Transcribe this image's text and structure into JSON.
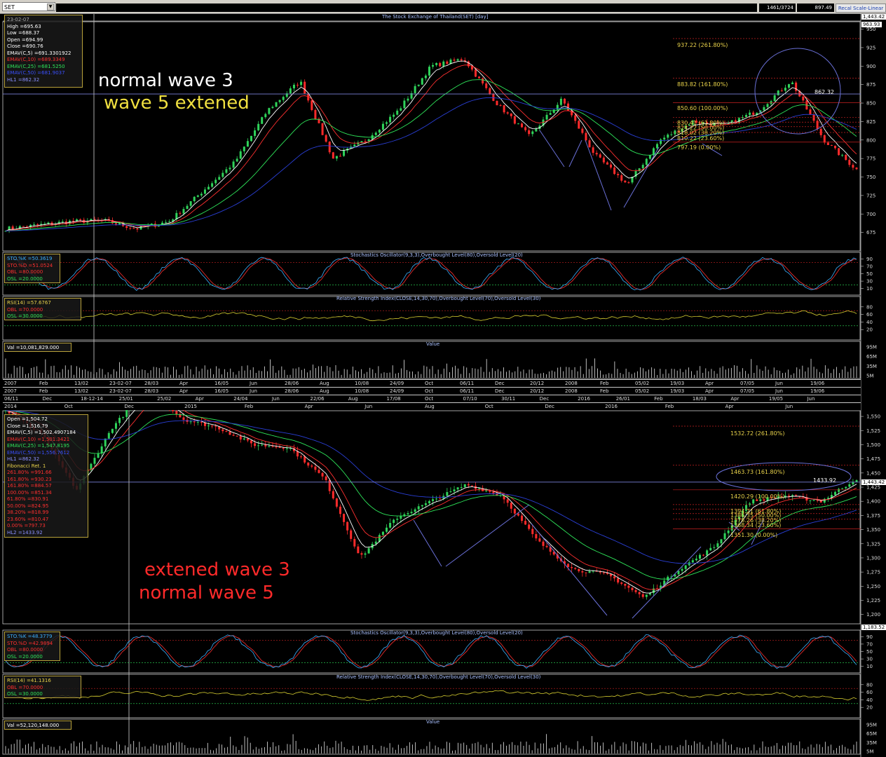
{
  "toolbar": {
    "symbol": "SET",
    "position": "1461/3724",
    "last_value": "897.49",
    "recalc_label": "Recal Scale-Linear"
  },
  "colors": {
    "up_candle": "#2fd35a",
    "down_candle": "#ff2b2b",
    "ema5": "#ffffff",
    "ema10": "#ff3030",
    "ema25": "#2ee65a",
    "ema50": "#2a3fd6",
    "hline": "#7a80d8",
    "stoch_k": "#3ab0ff",
    "stoch_d": "#ff3030",
    "rsi": "#d8d030",
    "volume": "#e8e8e8",
    "box_border": "#b8a23a"
  },
  "top": {
    "title": "The Stock Exchange of Thailand(SET) [day]",
    "annotation_white": "normal wave 3",
    "annotation_yellow": "wave 5 extened",
    "info": {
      "date": "23-02-07",
      "high": "High  =695.63",
      "low": "Low  =688.37",
      "open": "Open  =694.99",
      "close": "Close  =690.76",
      "ema5": "EMAV(C,5)  =691.3301922",
      "ema10": "EMAV(C,10)  =689.3349",
      "ema25": "EMAV(C,25)  =681.5250",
      "ema50": "EMAV(C,50)  =681.9037",
      "hl": "HL1 =862.32"
    },
    "right_labels": {
      "top": "1,443.42",
      "second": "963.93"
    },
    "fib_labels": [
      "937.22 (261.80%)",
      "883.82 (161.80%)",
      "850.60 (100.00%)",
      "830.41 (61.80%)",
      "824.22 (50.00%)",
      "818.02 (38.20%)",
      "810.22 (23.60%)",
      "797.19 (0.00%)"
    ],
    "hl_label": "862.32",
    "stoch": {
      "title": "Stochastics Oscillator(9,3,3),Overbought Level(80),Oversold Level(20)",
      "k": "STO.%K  =50.3619",
      "d": "STO.%D  =51.0524",
      "ob": "OBL  =80.0000",
      "os": "OSL  =20.0000"
    },
    "rsi": {
      "title": "Relative Strength Index(CLOSE,14,30,70),Overbought Level(70),Oversold Level(30)",
      "value": "RSI(14)  =57.6767",
      "ob": "OBL  =70.0000",
      "os": "OSL  =30.0000"
    },
    "volume": {
      "title": "Value",
      "value": "Val  =10,081,829.000"
    },
    "dates_row1": [
      "2007",
      "Feb",
      "13/02",
      "23-02-07",
      "28/03",
      "Apr",
      "16/05",
      "Jun",
      "28/06",
      "Aug",
      "10/08",
      "24/09",
      "Oct",
      "06/11",
      "Dec",
      "20/12",
      "2008",
      "Feb",
      "05/02",
      "19/03",
      "Apr",
      "07/05",
      "Jun",
      "19/06"
    ],
    "dates_row2": [
      "06/11",
      "Dec",
      "18-12-14",
      "25/01",
      "25/02",
      "Apr",
      "24/04",
      "Jun",
      "22/06",
      "Aug",
      "17/08",
      "Oct",
      "07/10",
      "30/11",
      "Dec",
      "2016",
      "26/01",
      "Feb",
      "18/03",
      "Apr",
      "19/05",
      "Jun"
    ]
  },
  "bottom": {
    "annotation_1": "extened wave 3",
    "annotation_2": "normal wave 5",
    "info": {
      "open": "Open  =1,504.72",
      "close": "Close  =1,516.79",
      "ema5": "EMAV(C,5)  =1,502.4907184",
      "ema10": "EMAV(C,10)  =1,501.3421",
      "ema25": "EMAV(C,25)  =1,547.8195",
      "ema50": "EMAV(C,50)  =1,556.7612",
      "hl1": "HL1 =862.32",
      "fib_title": "Fibonacci Ret. 1",
      "fib_rows": [
        "261.80% =991.66",
        "161.80% =930.23",
        "161.80% =884.57",
        "100.00% =851.34",
        "61.80% =830.91",
        "50.00% =824.95",
        "38.20% =818.99",
        "23.60% =810.47",
        "0.00% =797.73"
      ],
      "hl2": "HL2 =1433.92"
    },
    "fib_labels": [
      "1532.72 (261.80%)",
      "1463.73 (161.80%)",
      "1420.29 (100.00%)",
      "1394.21 (61.80%)",
      "1386.35 (50.00%)",
      "1378.26 (38.20%)",
      "1368.34 (23.60%)",
      "1351.30 (0.00%)"
    ],
    "hl_label": "1433.92",
    "right_labels": {
      "hl": "1,443.42",
      "bottom": "1,183.52"
    },
    "stoch": {
      "title": "Stochastics Oscillator(9,3,3),Overbought Level(80),Oversold Level(20)",
      "k": "STO.%K  =48.3779",
      "d": "STO.%D  =42.9894",
      "ob": "OBL  =80.0000",
      "os": "OSL  =20.0000"
    },
    "rsi": {
      "title": "Relative Strength Index(CLOSE,14,30,70),Overbought Level(70),Oversold Level(30)",
      "value": "RSI(14)  =41.1316",
      "ob": "OBL  =70.0000",
      "os": "OSL  =30.0000"
    },
    "volume": {
      "title": "Value",
      "value": "Val  =52,120,148.000"
    },
    "dates_row": [
      "2014",
      "Oct",
      "Dec",
      "2015",
      "Feb",
      "Apr",
      "Jun",
      "Aug",
      "Oct",
      "Dec",
      "2016",
      "Feb",
      "Apr",
      "Jun"
    ]
  },
  "chart_data": [
    {
      "type": "candlestick",
      "title": "The Stock Exchange of Thailand(SET) [day]",
      "ylim": [
        650,
        960
      ],
      "y_ticks": [
        675,
        700,
        725,
        750,
        775,
        800,
        825,
        850,
        875,
        900,
        925,
        950
      ],
      "x_range": [
        "Jan 2007",
        "Jun 2008"
      ],
      "close_path": [
        {
          "x": "Jan 2007",
          "y": 680
        },
        {
          "x": "Feb 2007",
          "y": 685
        },
        {
          "x": "13/02",
          "y": 690
        },
        {
          "x": "23-02-07",
          "y": 691
        },
        {
          "x": "28/03",
          "y": 680
        },
        {
          "x": "Apr 2007",
          "y": 690
        },
        {
          "x": "16/05",
          "y": 730
        },
        {
          "x": "Jun 2007",
          "y": 770
        },
        {
          "x": "28/06",
          "y": 840
        },
        {
          "x": "Jul 2007",
          "y": 880
        },
        {
          "x": "Aug 2007",
          "y": 775
        },
        {
          "x": "10/08",
          "y": 800
        },
        {
          "x": "24/09",
          "y": 840
        },
        {
          "x": "Oct 2007",
          "y": 900
        },
        {
          "x": "Oct 2007 high",
          "y": 910
        },
        {
          "x": "06/11",
          "y": 850
        },
        {
          "x": "Dec 2007",
          "y": 805
        },
        {
          "x": "20/12",
          "y": 855
        },
        {
          "x": "2008",
          "y": 780
        },
        {
          "x": "Jan 2008 low",
          "y": 740
        },
        {
          "x": "Feb 2008",
          "y": 800
        },
        {
          "x": "05/02",
          "y": 825
        },
        {
          "x": "19/03",
          "y": 820
        },
        {
          "x": "Apr 2008",
          "y": 840
        },
        {
          "x": "07/05",
          "y": 880
        },
        {
          "x": "Jun 2008",
          "y": 800
        },
        {
          "x": "19/06",
          "y": 760
        }
      ],
      "hline": 862.32,
      "fibonacci": [
        {
          "level": "261.80%",
          "value": 937.22
        },
        {
          "level": "161.80%",
          "value": 883.82
        },
        {
          "level": "100.00%",
          "value": 850.6
        },
        {
          "level": "61.80%",
          "value": 830.41
        },
        {
          "level": "50.00%",
          "value": 824.22
        },
        {
          "level": "38.20%",
          "value": 818.02
        },
        {
          "level": "23.60%",
          "value": 810.22
        },
        {
          "level": "0.00%",
          "value": 797.19
        }
      ]
    },
    {
      "type": "candlestick",
      "ylim": [
        1183.52,
        1560
      ],
      "y_ticks": [
        1200,
        1225,
        1250,
        1275,
        1300,
        1325,
        1350,
        1375,
        1400,
        1425,
        1450,
        1475,
        1500,
        1525,
        1550
      ],
      "x_range": [
        "Nov 2014",
        "Jun 2016"
      ],
      "close_path": [
        {
          "x": "06/11",
          "y": 1560
        },
        {
          "x": "Dec 2014",
          "y": 1520
        },
        {
          "x": "18-12-14",
          "y": 1420
        },
        {
          "x": "25/01",
          "y": 1530
        },
        {
          "x": "25/02",
          "y": 1600
        },
        {
          "x": "Apr 2015",
          "y": 1545
        },
        {
          "x": "24/04",
          "y": 1530
        },
        {
          "x": "Jun 2015",
          "y": 1500
        },
        {
          "x": "22/06",
          "y": 1495
        },
        {
          "x": "Jul 2015",
          "y": 1440
        },
        {
          "x": "Aug 2015",
          "y": 1300
        },
        {
          "x": "17/08",
          "y": 1370
        },
        {
          "x": "Sep 2015",
          "y": 1400
        },
        {
          "x": "07/10",
          "y": 1430
        },
        {
          "x": "Oct 2015",
          "y": 1410
        },
        {
          "x": "Nov 2015",
          "y": 1330
        },
        {
          "x": "30/11",
          "y": 1280
        },
        {
          "x": "Dec 2015",
          "y": 1270
        },
        {
          "x": "2016",
          "y": 1230
        },
        {
          "x": "26/01",
          "y": 1280
        },
        {
          "x": "Feb 2016",
          "y": 1320
        },
        {
          "x": "18/03",
          "y": 1400
        },
        {
          "x": "Apr 2016",
          "y": 1410
        },
        {
          "x": "19/05",
          "y": 1400
        },
        {
          "x": "Jun 2016",
          "y": 1440
        }
      ],
      "hline": 1433.92,
      "fibonacci": [
        {
          "level": "261.80%",
          "value": 1532.72
        },
        {
          "level": "161.80%",
          "value": 1463.73
        },
        {
          "level": "100.00%",
          "value": 1420.29
        },
        {
          "level": "61.80%",
          "value": 1394.21
        },
        {
          "level": "50.00%",
          "value": 1386.35
        },
        {
          "level": "38.20%",
          "value": 1378.26
        },
        {
          "level": "23.60%",
          "value": 1368.34
        },
        {
          "level": "0.00%",
          "value": 1351.3
        }
      ]
    }
  ],
  "axes": {
    "stoch_ticks": [
      "90",
      "70",
      "50",
      "30",
      "10"
    ],
    "rsi_ticks": [
      "80",
      "60",
      "40",
      "20"
    ],
    "vol_ticks": [
      "95M",
      "65M",
      "35M",
      "5M"
    ],
    "top_price_ticks": [
      "950",
      "925",
      "900",
      "875",
      "850",
      "825",
      "800",
      "775",
      "750",
      "725",
      "700",
      "675"
    ],
    "bottom_price_ticks": [
      "1,550",
      "1,525",
      "1,500",
      "1,475",
      "1,450",
      "1,425",
      "1,400",
      "1,375",
      "1,350",
      "1,325",
      "1,300",
      "1,275",
      "1,250",
      "1,225",
      "1,200"
    ]
  }
}
